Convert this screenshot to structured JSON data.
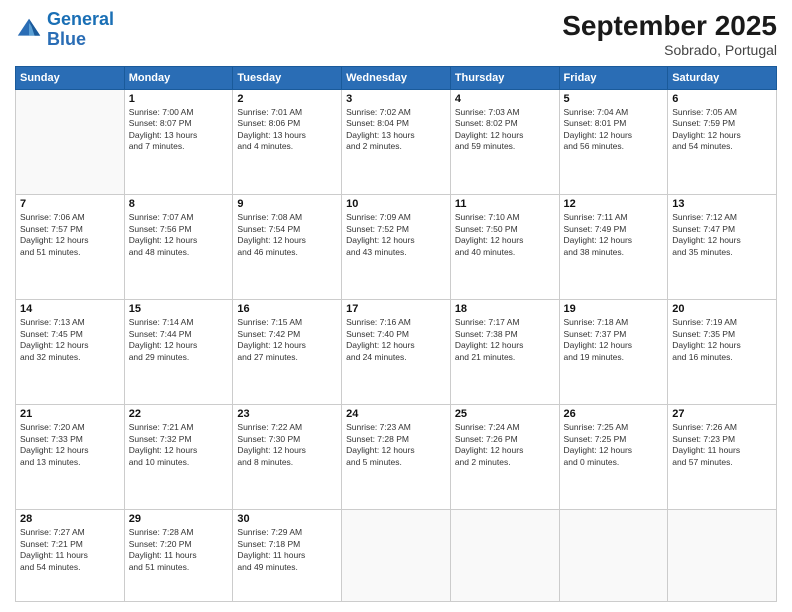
{
  "logo": {
    "line1": "General",
    "line2": "Blue"
  },
  "title": "September 2025",
  "subtitle": "Sobrado, Portugal",
  "weekdays": [
    "Sunday",
    "Monday",
    "Tuesday",
    "Wednesday",
    "Thursday",
    "Friday",
    "Saturday"
  ],
  "weeks": [
    [
      {
        "day": "",
        "info": ""
      },
      {
        "day": "1",
        "info": "Sunrise: 7:00 AM\nSunset: 8:07 PM\nDaylight: 13 hours\nand 7 minutes."
      },
      {
        "day": "2",
        "info": "Sunrise: 7:01 AM\nSunset: 8:06 PM\nDaylight: 13 hours\nand 4 minutes."
      },
      {
        "day": "3",
        "info": "Sunrise: 7:02 AM\nSunset: 8:04 PM\nDaylight: 13 hours\nand 2 minutes."
      },
      {
        "day": "4",
        "info": "Sunrise: 7:03 AM\nSunset: 8:02 PM\nDaylight: 12 hours\nand 59 minutes."
      },
      {
        "day": "5",
        "info": "Sunrise: 7:04 AM\nSunset: 8:01 PM\nDaylight: 12 hours\nand 56 minutes."
      },
      {
        "day": "6",
        "info": "Sunrise: 7:05 AM\nSunset: 7:59 PM\nDaylight: 12 hours\nand 54 minutes."
      }
    ],
    [
      {
        "day": "7",
        "info": "Sunrise: 7:06 AM\nSunset: 7:57 PM\nDaylight: 12 hours\nand 51 minutes."
      },
      {
        "day": "8",
        "info": "Sunrise: 7:07 AM\nSunset: 7:56 PM\nDaylight: 12 hours\nand 48 minutes."
      },
      {
        "day": "9",
        "info": "Sunrise: 7:08 AM\nSunset: 7:54 PM\nDaylight: 12 hours\nand 46 minutes."
      },
      {
        "day": "10",
        "info": "Sunrise: 7:09 AM\nSunset: 7:52 PM\nDaylight: 12 hours\nand 43 minutes."
      },
      {
        "day": "11",
        "info": "Sunrise: 7:10 AM\nSunset: 7:50 PM\nDaylight: 12 hours\nand 40 minutes."
      },
      {
        "day": "12",
        "info": "Sunrise: 7:11 AM\nSunset: 7:49 PM\nDaylight: 12 hours\nand 38 minutes."
      },
      {
        "day": "13",
        "info": "Sunrise: 7:12 AM\nSunset: 7:47 PM\nDaylight: 12 hours\nand 35 minutes."
      }
    ],
    [
      {
        "day": "14",
        "info": "Sunrise: 7:13 AM\nSunset: 7:45 PM\nDaylight: 12 hours\nand 32 minutes."
      },
      {
        "day": "15",
        "info": "Sunrise: 7:14 AM\nSunset: 7:44 PM\nDaylight: 12 hours\nand 29 minutes."
      },
      {
        "day": "16",
        "info": "Sunrise: 7:15 AM\nSunset: 7:42 PM\nDaylight: 12 hours\nand 27 minutes."
      },
      {
        "day": "17",
        "info": "Sunrise: 7:16 AM\nSunset: 7:40 PM\nDaylight: 12 hours\nand 24 minutes."
      },
      {
        "day": "18",
        "info": "Sunrise: 7:17 AM\nSunset: 7:38 PM\nDaylight: 12 hours\nand 21 minutes."
      },
      {
        "day": "19",
        "info": "Sunrise: 7:18 AM\nSunset: 7:37 PM\nDaylight: 12 hours\nand 19 minutes."
      },
      {
        "day": "20",
        "info": "Sunrise: 7:19 AM\nSunset: 7:35 PM\nDaylight: 12 hours\nand 16 minutes."
      }
    ],
    [
      {
        "day": "21",
        "info": "Sunrise: 7:20 AM\nSunset: 7:33 PM\nDaylight: 12 hours\nand 13 minutes."
      },
      {
        "day": "22",
        "info": "Sunrise: 7:21 AM\nSunset: 7:32 PM\nDaylight: 12 hours\nand 10 minutes."
      },
      {
        "day": "23",
        "info": "Sunrise: 7:22 AM\nSunset: 7:30 PM\nDaylight: 12 hours\nand 8 minutes."
      },
      {
        "day": "24",
        "info": "Sunrise: 7:23 AM\nSunset: 7:28 PM\nDaylight: 12 hours\nand 5 minutes."
      },
      {
        "day": "25",
        "info": "Sunrise: 7:24 AM\nSunset: 7:26 PM\nDaylight: 12 hours\nand 2 minutes."
      },
      {
        "day": "26",
        "info": "Sunrise: 7:25 AM\nSunset: 7:25 PM\nDaylight: 12 hours\nand 0 minutes."
      },
      {
        "day": "27",
        "info": "Sunrise: 7:26 AM\nSunset: 7:23 PM\nDaylight: 11 hours\nand 57 minutes."
      }
    ],
    [
      {
        "day": "28",
        "info": "Sunrise: 7:27 AM\nSunset: 7:21 PM\nDaylight: 11 hours\nand 54 minutes."
      },
      {
        "day": "29",
        "info": "Sunrise: 7:28 AM\nSunset: 7:20 PM\nDaylight: 11 hours\nand 51 minutes."
      },
      {
        "day": "30",
        "info": "Sunrise: 7:29 AM\nSunset: 7:18 PM\nDaylight: 11 hours\nand 49 minutes."
      },
      {
        "day": "",
        "info": ""
      },
      {
        "day": "",
        "info": ""
      },
      {
        "day": "",
        "info": ""
      },
      {
        "day": "",
        "info": ""
      }
    ]
  ]
}
